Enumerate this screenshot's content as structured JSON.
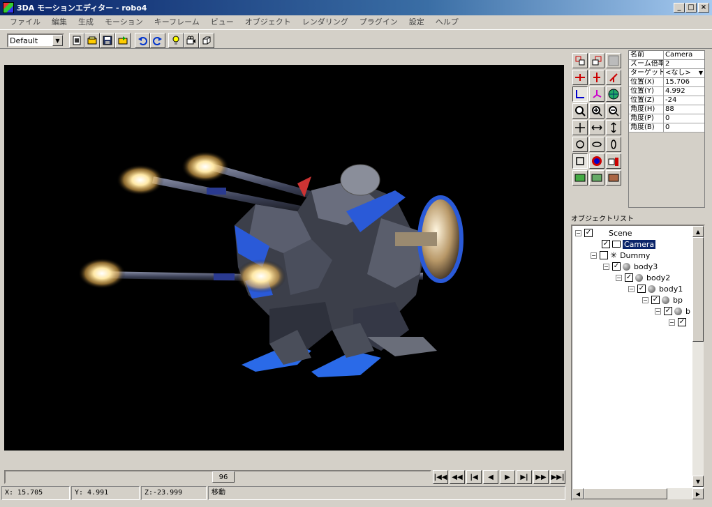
{
  "window": {
    "title": "3DA モーションエディター - robo4"
  },
  "menu": [
    "ファイル",
    "編集",
    "生成",
    "モーション",
    "キーフレーム",
    "ビュー",
    "オブジェクト",
    "レンダリング",
    "プラグイン",
    "設定",
    "ヘルプ"
  ],
  "toolbar": {
    "preset_value": "Default"
  },
  "properties": [
    {
      "label": "名前",
      "value": "Camera"
    },
    {
      "label": "ズーム倍率",
      "value": "2"
    },
    {
      "label": "ターゲット",
      "value": "<なし>"
    },
    {
      "label": "位置(X)",
      "value": "15.706"
    },
    {
      "label": "位置(Y)",
      "value": "4.992"
    },
    {
      "label": "位置(Z)",
      "value": "-24"
    },
    {
      "label": "角度(H)",
      "value": "88"
    },
    {
      "label": "角度(P)",
      "value": "0"
    },
    {
      "label": "角度(B)",
      "value": "0"
    }
  ],
  "object_list": {
    "label": "オブジェクトリスト",
    "nodes": [
      {
        "name": "Scene",
        "checked": true
      },
      {
        "name": "Camera",
        "checked": true,
        "selected": true
      },
      {
        "name": "Dummy",
        "checked": false
      },
      {
        "name": "body3",
        "checked": true
      },
      {
        "name": "body2",
        "checked": true
      },
      {
        "name": "body1",
        "checked": true
      },
      {
        "name": "bp",
        "checked": true
      },
      {
        "name": "b",
        "checked": true
      },
      {
        "name": "",
        "checked": true
      }
    ]
  },
  "timeline": {
    "frame": "96"
  },
  "status": {
    "x": "X: 15.705",
    "y": "Y: 4.991",
    "z": "Z:-23.999",
    "mode": "移動"
  },
  "icons": [
    "new-icon",
    "open-icon",
    "save-icon",
    "export-icon",
    "undo-icon",
    "redo-icon",
    "light-icon",
    "camera-icon",
    "box-icon"
  ],
  "colors": {
    "title_active": "#0a246a",
    "face": "#d4d0c8",
    "viewport": "#000000"
  }
}
